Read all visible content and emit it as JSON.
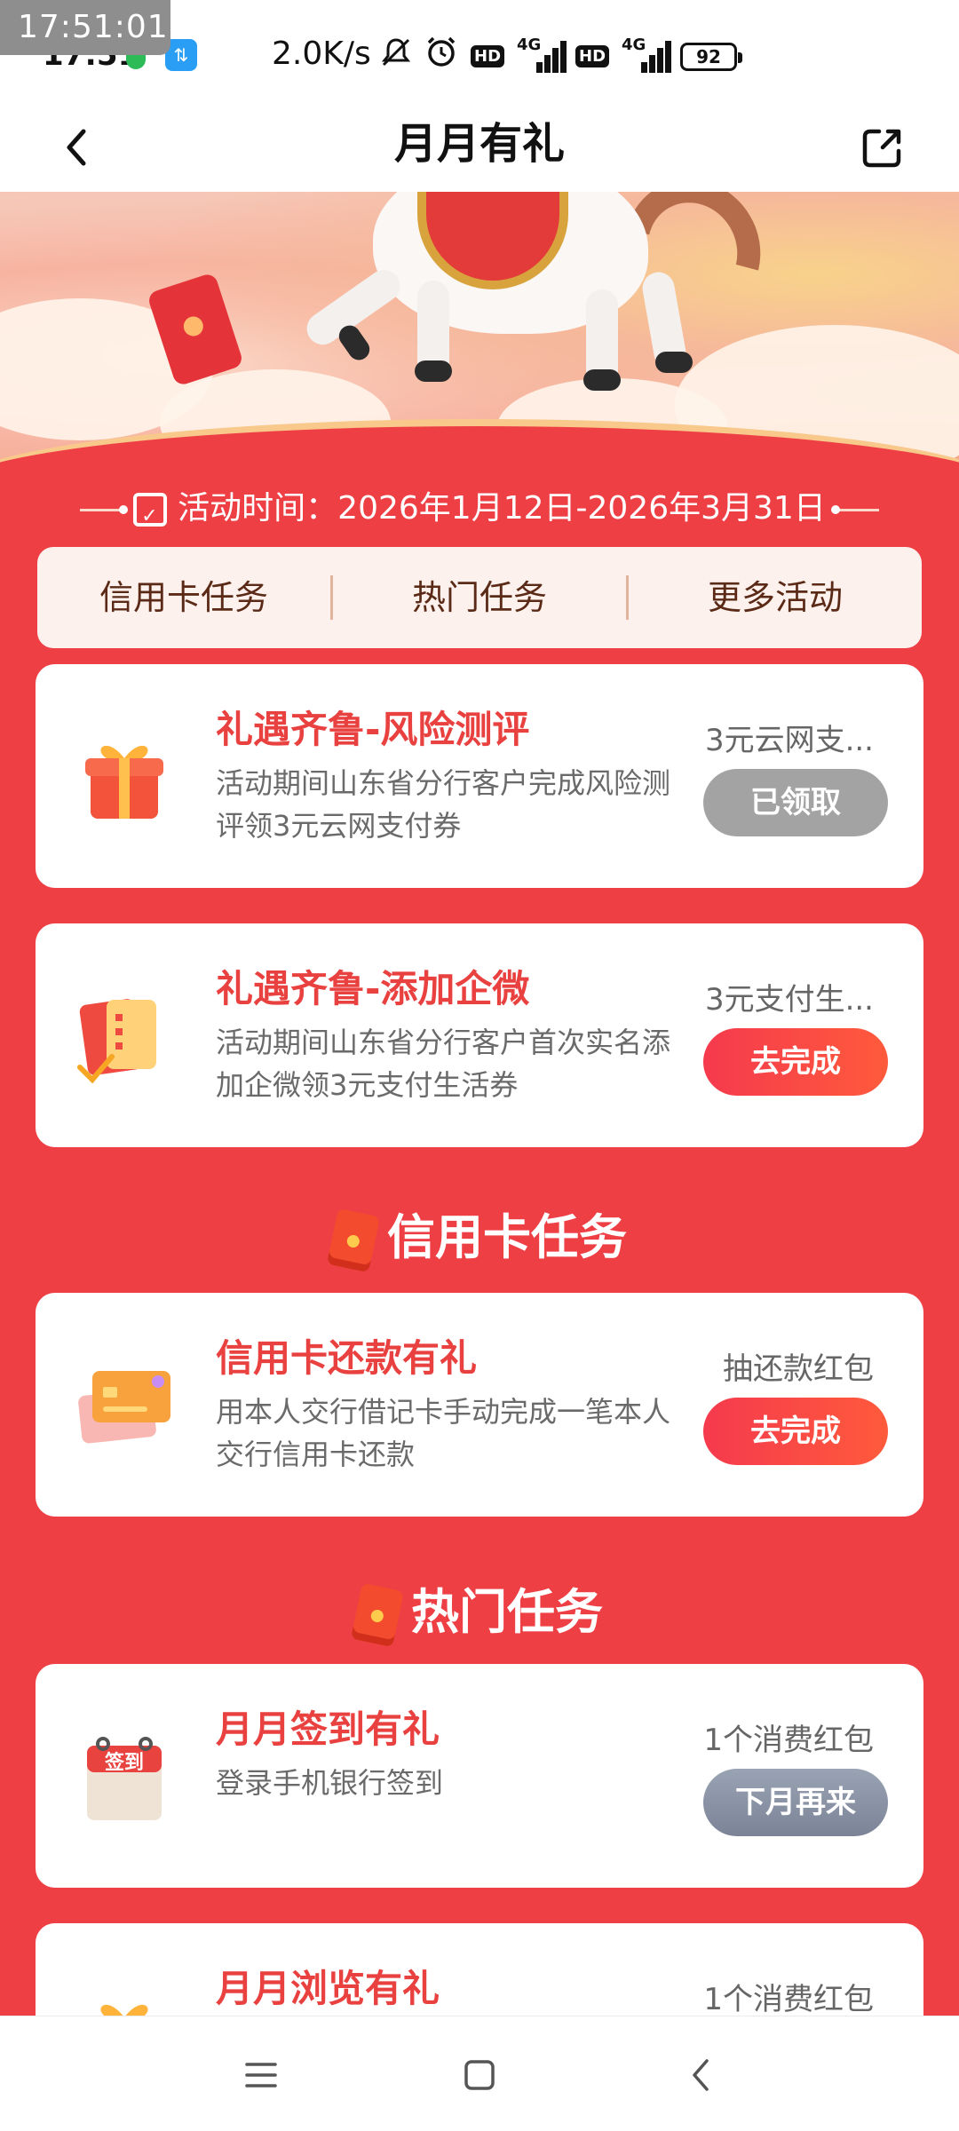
{
  "status_bar": {
    "overlay_time": "17:51:01",
    "time": "17:51",
    "net_speed": "2.0K/s",
    "net_type_1": "4G",
    "net_type_2": "4G",
    "hd_label": "HD",
    "battery": "92"
  },
  "nav": {
    "title": "月月有礼"
  },
  "activity": {
    "time_text": "活动时间：2026年1月12日-2026年3月31日"
  },
  "tabs": [
    "信用卡任务",
    "热门任务",
    "更多活动"
  ],
  "cards": [
    {
      "title": "礼遇齐鲁-风险测评",
      "desc": "活动期间山东省分行客户完成风险测评领3元云网支付券",
      "reward": "3元云网支...",
      "button": "已领取",
      "icon": "gift-box-icon"
    },
    {
      "title": "礼遇齐鲁-添加企微",
      "desc": "活动期间山东省分行客户首次实名添加企微领3元支付生活券",
      "reward": "3元支付生...",
      "button": "去完成",
      "icon": "coupon-card-icon"
    },
    {
      "title": "信用卡还款有礼",
      "desc": "用本人交行借记卡手动完成一笔本人交行信用卡还款",
      "reward": "抽还款红包",
      "button": "去完成",
      "icon": "credit-card-icon"
    },
    {
      "title": "月月签到有礼",
      "desc": "登录手机银行签到",
      "reward": "1个消费红包",
      "button": "下月再来",
      "icon": "sign-in-calendar-icon",
      "icon_text": "签到"
    },
    {
      "title": "月月浏览有礼",
      "reward": "1个消费红包",
      "icon": "gift-box-icon"
    }
  ],
  "sections": {
    "credit_card": "信用卡任务",
    "hot": "热门任务"
  },
  "colors": {
    "page_bg": "#ee3f45",
    "title_red": "#e8413f",
    "button_red": "#f53a4d",
    "button_grey": "#a3a3a3"
  }
}
